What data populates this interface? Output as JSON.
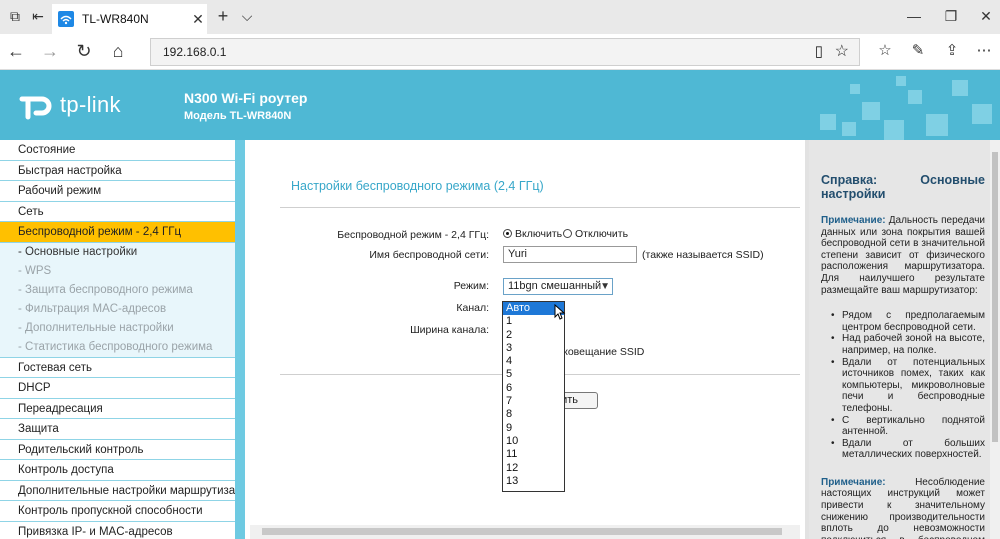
{
  "browser": {
    "tab_title": "TL-WR840N",
    "tab_close": "✕",
    "new_tab": "+",
    "tab_list": "⌵",
    "win_min": "—",
    "win_max": "❐",
    "win_close": "✕",
    "url": "192.168.0.1"
  },
  "header": {
    "logo_text": "tp-link",
    "product": "N300 Wi-Fi роутер",
    "model": "Модель TL-WR840N"
  },
  "sidebar": {
    "items": [
      {
        "label": "Состояние",
        "state": "normal"
      },
      {
        "label": "Быстрая настройка",
        "state": "normal"
      },
      {
        "label": "Рабочий режим",
        "state": "normal"
      },
      {
        "label": "Сеть",
        "state": "normal"
      },
      {
        "label": "Беспроводной режим - 2,4 ГГц",
        "state": "active"
      },
      {
        "label": "- Основные настройки",
        "state": "sub-current"
      },
      {
        "label": "- WPS",
        "state": "sub"
      },
      {
        "label": "- Защита беспроводного режима",
        "state": "sub"
      },
      {
        "label": "- Фильтрация MAC-адресов",
        "state": "sub"
      },
      {
        "label": "- Дополнительные настройки",
        "state": "sub"
      },
      {
        "label": "- Статистика беспроводного режима",
        "state": "sub"
      },
      {
        "label": "Гостевая сеть",
        "state": "normal"
      },
      {
        "label": "DHCP",
        "state": "normal"
      },
      {
        "label": "Переадресация",
        "state": "normal"
      },
      {
        "label": "Защита",
        "state": "normal"
      },
      {
        "label": "Родительский контроль",
        "state": "normal"
      },
      {
        "label": "Контроль доступа",
        "state": "normal"
      },
      {
        "label": "Дополнительные настройки маршрутизац",
        "state": "normal"
      },
      {
        "label": "Контроль пропускной способности",
        "state": "normal"
      },
      {
        "label": "Привязка IP- и MAC-адресов",
        "state": "normal"
      }
    ]
  },
  "form": {
    "title": "Настройки беспроводного режима (2,4 ГГц)",
    "radio_label": "Беспроводной режим - 2,4 ГГц:",
    "radio_on": "Включить",
    "radio_off": "Отключить",
    "ssid_label": "Имя беспроводной сети:",
    "ssid_value": "Yuri",
    "ssid_hint": "(также называется SSID)",
    "mode_label": "Режим:",
    "mode_value": "11bgn смешанный",
    "channel_label": "Канал:",
    "width_label": "Ширина канала:",
    "broadcast_text": "вироковещание SSID",
    "save_button": "нить",
    "channel_options": [
      "Авто",
      "1",
      "2",
      "3",
      "4",
      "5",
      "6",
      "7",
      "8",
      "9",
      "10",
      "11",
      "12",
      "13"
    ],
    "channel_selected": "Авто"
  },
  "help": {
    "title": "Справка: Основные настройки",
    "note_label": "Примечание:",
    "note1": "Дальность передачи данных или зона покрытия вашей беспроводной сети в значительной степени зависит от физического расположения маршрутизатора. Для наилучшего результате размещайте ваш маршрутизатор:",
    "bullets": [
      "Рядом с предполагаемым центром беспроводной сети.",
      "Над рабочей зоной на высоте, например, на полке.",
      "Вдали от потенциальных источников помех, таких как компьютеры, микроволновые печи и беспроводные телефоны.",
      "С вертикально поднятой антенной.",
      "Вдали от больших металлических поверхностей."
    ],
    "note2": "Несоблюдение настоящих инструкций может привести к значительному снижению производительности вплоть до невозможности подключиться в беспроводном режиме к вашему маршрутизатору."
  },
  "colors": {
    "banner": "#4fb8d4",
    "active_menu": "#ffc000",
    "accent_text": "#37a7c9"
  }
}
